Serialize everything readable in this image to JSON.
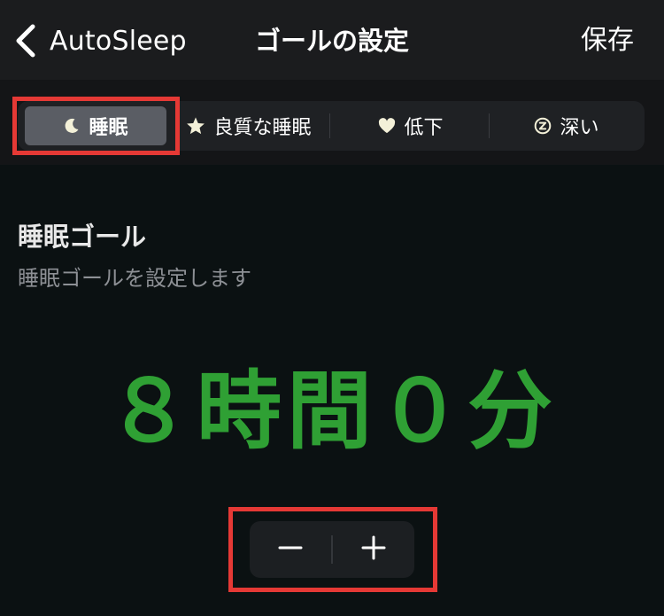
{
  "navbar": {
    "back_label": "AutoSleep",
    "title": "ゴールの設定",
    "save_label": "保存"
  },
  "segments": [
    {
      "label": "睡眠",
      "icon": "moon-icon",
      "selected": true
    },
    {
      "label": "良質な睡眠",
      "icon": "star-icon",
      "selected": false
    },
    {
      "label": "低下",
      "icon": "heart-icon",
      "selected": false
    },
    {
      "label": "深い",
      "icon": "z-circle-icon",
      "selected": false
    }
  ],
  "section": {
    "title": "睡眠ゴール",
    "subtitle": "睡眠ゴールを設定します"
  },
  "goal": {
    "display": "８時間０分"
  },
  "stepper": {
    "minus_icon": "minus-icon",
    "plus_icon": "plus-icon"
  },
  "colors": {
    "background": "#050708",
    "navbar": "#1b1c1e",
    "goal_text": "#2fa034",
    "selected_segment": "#5a5d64",
    "highlight": "#e53935"
  }
}
